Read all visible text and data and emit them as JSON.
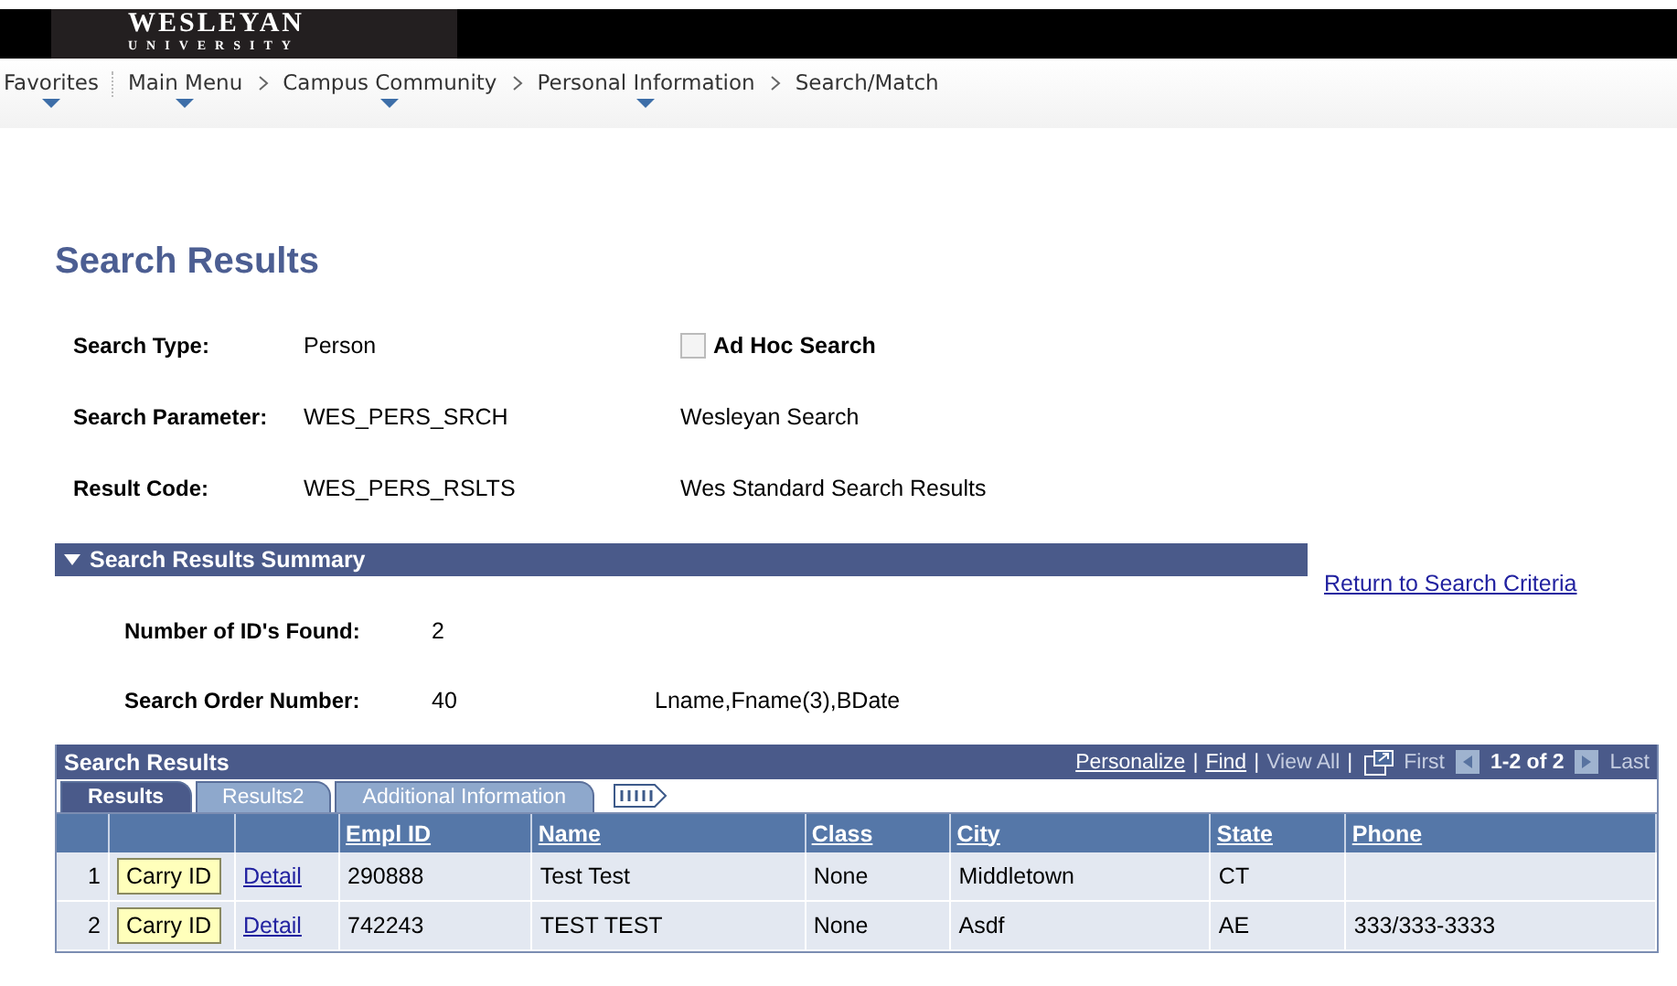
{
  "header": {
    "logo_title": "WESLEYAN",
    "logo_subtitle": "UNIVERSITY"
  },
  "breadcrumb": [
    {
      "label": "Favorites",
      "menu": true
    },
    {
      "label": "Main Menu",
      "menu": true
    },
    {
      "label": "Campus Community",
      "menu": true
    },
    {
      "label": "Personal Information",
      "menu": true
    },
    {
      "label": "Search/Match",
      "menu": false
    }
  ],
  "page_title": "Search Results",
  "fields": [
    {
      "label": "Search Type:",
      "value": "Person",
      "extra": "Ad Hoc Search",
      "kind": "checkbox",
      "checked": false
    },
    {
      "label": "Search Parameter:",
      "value": "WES_PERS_SRCH",
      "extra": "Wesleyan Search",
      "kind": "text"
    },
    {
      "label": "Result Code:",
      "value": "WES_PERS_RSLTS",
      "extra": "Wes Standard Search Results",
      "kind": "text"
    }
  ],
  "summary": {
    "title": "Search Results Summary",
    "expanded": true,
    "link": "Return to Search Criteria",
    "rows": [
      {
        "label": "Number of ID's Found:",
        "value": "2"
      },
      {
        "label": "Search Order Number:",
        "value": "40",
        "extra": "Lname,Fname(3),BDate"
      }
    ]
  },
  "grid": {
    "title": "Search Results",
    "nav": [
      {
        "label": "Personalize",
        "kind": "link"
      },
      {
        "label": "|",
        "kind": "sep"
      },
      {
        "label": "Find",
        "kind": "link"
      },
      {
        "label": "|",
        "kind": "sep"
      },
      {
        "label": "View All",
        "kind": "disabled"
      },
      {
        "label": "|",
        "kind": "sep"
      },
      {
        "kind": "zoom-icon"
      },
      {
        "label": "First",
        "kind": "disabled"
      },
      {
        "kind": "prev-icon"
      },
      {
        "label": "1-2 of 2",
        "kind": "count"
      },
      {
        "kind": "next-icon"
      },
      {
        "label": "Last",
        "kind": "disabled"
      }
    ],
    "tabs": [
      {
        "label": "Results",
        "selected": true
      },
      {
        "label": "Results2",
        "selected": false
      },
      {
        "label": "Additional Information",
        "selected": false
      }
    ],
    "columns": [
      "Empl ID",
      "Name",
      "Class",
      "City",
      "State",
      "Phone"
    ],
    "rows": [
      {
        "number": "1",
        "button": "Carry ID",
        "link": "Detail",
        "cells": [
          "290888",
          "Test Test",
          "None",
          "Middletown",
          "CT"
        ]
      },
      {
        "number": "2",
        "button": "Carry ID",
        "link": "Detail",
        "cells": [
          "742243",
          "TEST TEST",
          "None",
          "Asdf",
          "AE",
          "333/333-3333"
        ]
      }
    ]
  }
}
